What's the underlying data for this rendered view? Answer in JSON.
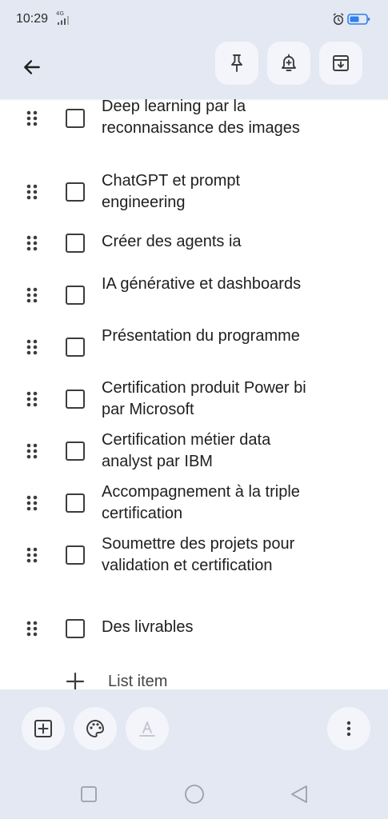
{
  "status_bar": {
    "time": "10:29",
    "network": "4G"
  },
  "toolbar": {
    "back_icon": "arrow-back-icon",
    "pin_icon": "pin-icon",
    "reminder_icon": "add-alert-icon",
    "archive_icon": "archive-icon"
  },
  "checklist": {
    "items": [
      {
        "text": "Deep learning par la reconnaissance des images",
        "checked": false
      },
      {
        "text": "ChatGPT et prompt engineering",
        "checked": false
      },
      {
        "text": "Créer des agents ia",
        "checked": false
      },
      {
        "text": "IA générative et dashboards",
        "checked": false
      },
      {
        "text": "Présentation du programme",
        "checked": false
      },
      {
        "text": "Certification produit Power bi par Microsoft",
        "checked": false
      },
      {
        "text": "Certification métier data analyst par IBM",
        "checked": false
      },
      {
        "text": "Accompagnement à la triple certification",
        "checked": false
      },
      {
        "text": "Soumettre des projets pour validation et certification",
        "checked": false
      },
      {
        "text": "Des livrables",
        "checked": false
      }
    ],
    "add_label": "List item"
  },
  "bottom_bar": {
    "add_icon": "add-box-icon",
    "palette_icon": "palette-icon",
    "text_format_icon": "text-format-icon",
    "more_icon": "more-vert-icon"
  },
  "nav": {
    "recents_icon": "square-icon",
    "home_icon": "circle-icon",
    "back_icon": "triangle-back-icon"
  }
}
